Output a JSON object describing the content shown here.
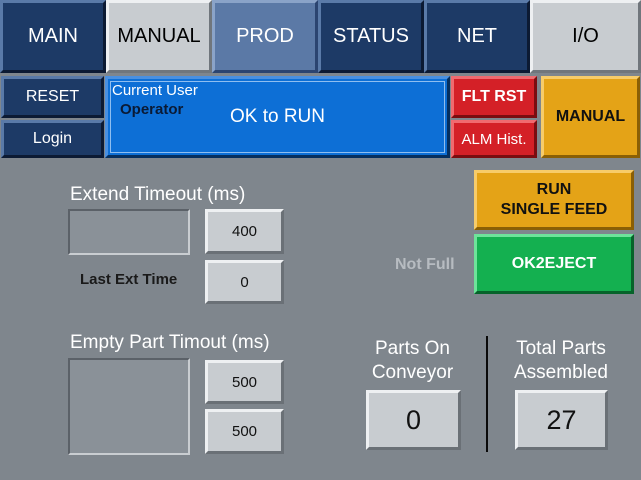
{
  "tabs": [
    {
      "label": "MAIN"
    },
    {
      "label": "MANUAL"
    },
    {
      "label": "PROD"
    },
    {
      "label": "STATUS"
    },
    {
      "label": "NET"
    },
    {
      "label": "I/O"
    }
  ],
  "left_buttons": {
    "reset": "RESET",
    "login": "Login"
  },
  "status_panel": {
    "current_user_label": "Current User",
    "user": "Operator",
    "message": "OK to RUN"
  },
  "fault_buttons": {
    "flt_rst": "FLT RST",
    "alm_hist": "ALM Hist."
  },
  "mode_button": "MANUAL",
  "run_button": {
    "line1": "RUN",
    "line2": "SINGLE FEED"
  },
  "eject": {
    "status": "Not Full",
    "button": "OK2EJECT"
  },
  "extend": {
    "title": "Extend Timeout (ms)",
    "value": "400",
    "last_label": "Last Ext Time",
    "last_value": "0"
  },
  "empty_part": {
    "title": "Empty Part Timout (ms)",
    "value1": "500",
    "value2": "500"
  },
  "counters": {
    "parts_on_conveyor_line1": "Parts On",
    "parts_on_conveyor_line2": "Conveyor",
    "parts_on_conveyor_value": "0",
    "total_parts_line1": "Total Parts",
    "total_parts_line2": "Assembled",
    "total_parts_value": "27"
  },
  "colors": {
    "background": "#7f868d",
    "tab_dark": "#1d3a66",
    "tab_active": "#5b79a6",
    "status_blue": "#0d6fd6",
    "fault_red": "#d42027",
    "manual_orange": "#e4a317",
    "eject_green": "#14b050"
  }
}
